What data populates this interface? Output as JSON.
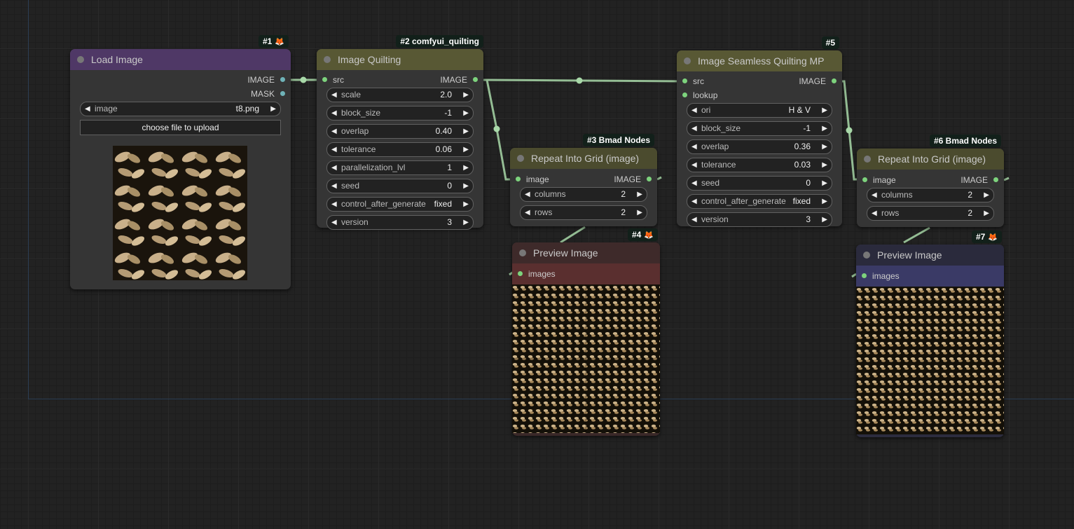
{
  "colors": {
    "canvas": "#222222",
    "link": "#a8d8a8",
    "slot": "#7dd37d",
    "load_title": "#4f3866",
    "quilt_title": "#585834",
    "grid_title": "#4b4b2e",
    "preview4_title": "#3e2a2a",
    "preview4_bar": "#5a2f2f",
    "preview7_title": "#2a2a3c",
    "preview7_bar": "#3a3a66"
  },
  "nodes": {
    "load_image": {
      "badge": "#1",
      "title": "Load Image",
      "outputs": [
        "IMAGE",
        "MASK"
      ],
      "image_widget": {
        "label": "image",
        "value": "t8.png"
      },
      "upload_label": "choose file to upload"
    },
    "quilting": {
      "badge": "#2 comfyui_quilting",
      "title": "Image Quilting",
      "input": "src",
      "output": "IMAGE",
      "widgets": [
        {
          "label": "scale",
          "value": "2.0"
        },
        {
          "label": "block_size",
          "value": "-1"
        },
        {
          "label": "overlap",
          "value": "0.40"
        },
        {
          "label": "tolerance",
          "value": "0.06"
        },
        {
          "label": "parallelization_lvl",
          "value": "1"
        },
        {
          "label": "seed",
          "value": "0"
        },
        {
          "label": "control_after_generate",
          "value": "fixed"
        },
        {
          "label": "version",
          "value": "3"
        }
      ]
    },
    "grid3": {
      "badge": "#3 Bmad Nodes",
      "title": "Repeat Into Grid (image)",
      "input": "image",
      "output": "IMAGE",
      "widgets": [
        {
          "label": "columns",
          "value": "2"
        },
        {
          "label": "rows",
          "value": "2"
        }
      ]
    },
    "preview4": {
      "badge": "#4",
      "title": "Preview Image",
      "input": "images"
    },
    "seamless": {
      "badge": "#5",
      "title": "Image Seamless Quilting MP",
      "inputs": [
        "src",
        "lookup"
      ],
      "output": "IMAGE",
      "widgets": [
        {
          "label": "ori",
          "value": "H & V"
        },
        {
          "label": "block_size",
          "value": "-1"
        },
        {
          "label": "overlap",
          "value": "0.36"
        },
        {
          "label": "tolerance",
          "value": "0.03"
        },
        {
          "label": "seed",
          "value": "0"
        },
        {
          "label": "control_after_generate",
          "value": "fixed"
        },
        {
          "label": "version",
          "value": "3"
        }
      ]
    },
    "grid6": {
      "badge": "#6 Bmad Nodes",
      "title": "Repeat Into Grid (image)",
      "input": "image",
      "output": "IMAGE",
      "widgets": [
        {
          "label": "columns",
          "value": "2"
        },
        {
          "label": "rows",
          "value": "2"
        }
      ]
    },
    "preview7": {
      "badge": "#7",
      "title": "Preview Image",
      "input": "images"
    }
  }
}
